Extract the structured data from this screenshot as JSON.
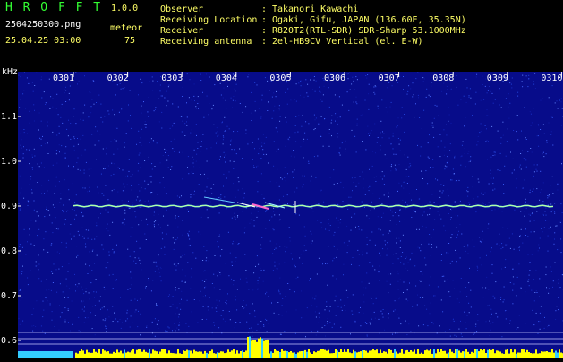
{
  "header": {
    "app_title": "H R O F F T",
    "version": "1.0.0",
    "filename": "2504250300.png",
    "datetime": "25.04.25 03:00",
    "meteor_label": "meteor",
    "meteor_count": "75",
    "info": [
      {
        "key": "Observer",
        "value": "Takanori Kawachi"
      },
      {
        "key": "Receiving Location",
        "value": "Ogaki, Gifu, JAPAN (136.60E, 35.35N)"
      },
      {
        "key": "Receiver",
        "value": "R820T2(RTL-SDR) SDR-Sharp 53.1000MHz"
      },
      {
        "key": "Receiving antenna",
        "value": "2el-HB9CV Vertical (el. E-W)"
      }
    ],
    "separator": ":"
  },
  "spectrogram": {
    "y_unit": "kHz",
    "y_ticks": [
      "1.1",
      "1.0",
      "0.9",
      "0.8",
      "0.7",
      "0.6"
    ],
    "x_ticks": [
      "0301",
      "0302",
      "0303",
      "0304",
      "0305",
      "0306",
      "0307",
      "0308",
      "0309",
      "0310"
    ],
    "background_color": "#070c8a",
    "carrier_color": "#7fffd4",
    "activity_color": "#ffff00"
  }
}
